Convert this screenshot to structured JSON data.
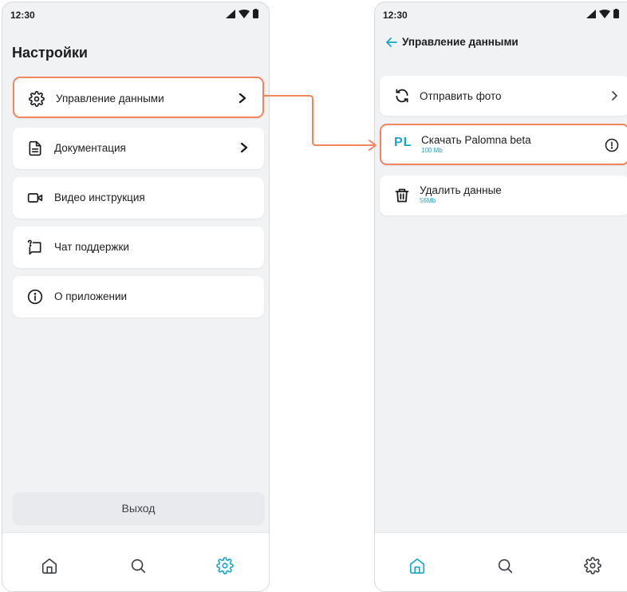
{
  "status": {
    "time": "12:30"
  },
  "settings": {
    "title": "Настройки",
    "items": [
      {
        "label": "Управление данными",
        "icon": "gear-icon"
      },
      {
        "label": "Документация",
        "icon": "document-icon"
      },
      {
        "label": "Видео инструкция",
        "icon": "video-icon"
      },
      {
        "label": "Чат поддержки",
        "icon": "chat-icon"
      },
      {
        "label": "О приложении",
        "icon": "info-icon"
      }
    ],
    "logout": "Выход"
  },
  "data_management": {
    "title": "Управление данными",
    "items": [
      {
        "label": "Отправить фото",
        "icon": "sync-icon"
      },
      {
        "label": "Скачать Palomna beta",
        "sub": "100 Mb",
        "logo": "PL"
      },
      {
        "label": "Удалить данные",
        "sub": "56Mb",
        "icon": "trash-icon"
      }
    ]
  },
  "nav": [
    "home-icon",
    "search-icon",
    "gear-icon"
  ],
  "colors": {
    "accent": "#18a7c8",
    "highlight": "#f0855e",
    "background": "#f1f2f4"
  }
}
